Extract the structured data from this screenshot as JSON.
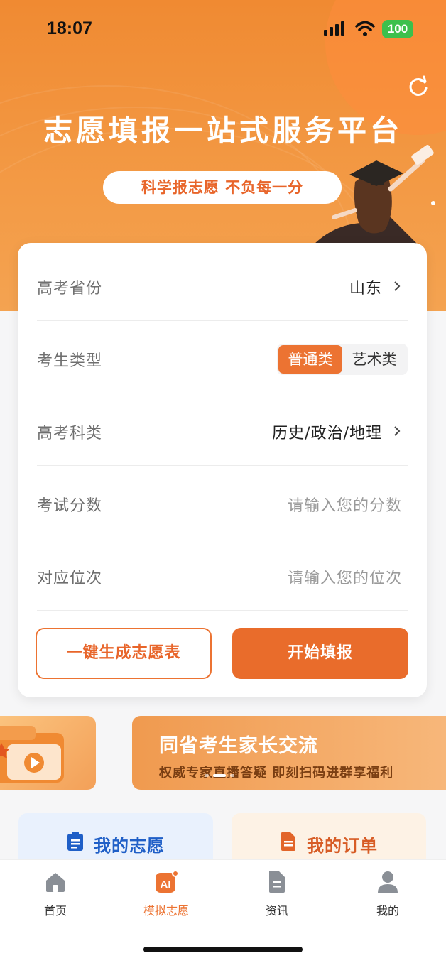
{
  "status_bar": {
    "time": "18:07",
    "battery": "100"
  },
  "hero": {
    "title": "志愿填报一站式服务平台",
    "slogan": "科学报志愿  不负每一分"
  },
  "form": {
    "province": {
      "label": "高考省份",
      "value": "山东"
    },
    "student_type": {
      "label": "考生类型",
      "options": [
        "普通类",
        "艺术类"
      ],
      "selected": "普通类"
    },
    "subjects": {
      "label": "高考科类",
      "value": "历史/政治/地理"
    },
    "score": {
      "label": "考试分数",
      "placeholder": "请输入您的分数"
    },
    "rank": {
      "label": "对应位次",
      "placeholder": "请输入您的位次"
    },
    "generate_button": "一键生成志愿表",
    "start_button": "开始填报"
  },
  "banner": {
    "title": "同省考生家长交流",
    "subtitle": "权威专家直播答疑  即刻扫码进群享福利"
  },
  "quick": {
    "my_wishes": "我的志愿",
    "my_orders": "我的订单"
  },
  "tabbar": {
    "items": [
      {
        "label": "首页",
        "icon": "home-icon"
      },
      {
        "label": "模拟志愿",
        "icon": "ai-icon"
      },
      {
        "label": "资讯",
        "icon": "news-icon"
      },
      {
        "label": "我的",
        "icon": "user-icon"
      }
    ],
    "active": "模拟志愿"
  },
  "colors": {
    "accent": "#ec7332",
    "hero": "#f08a32",
    "blue": "#1f5fc7"
  }
}
